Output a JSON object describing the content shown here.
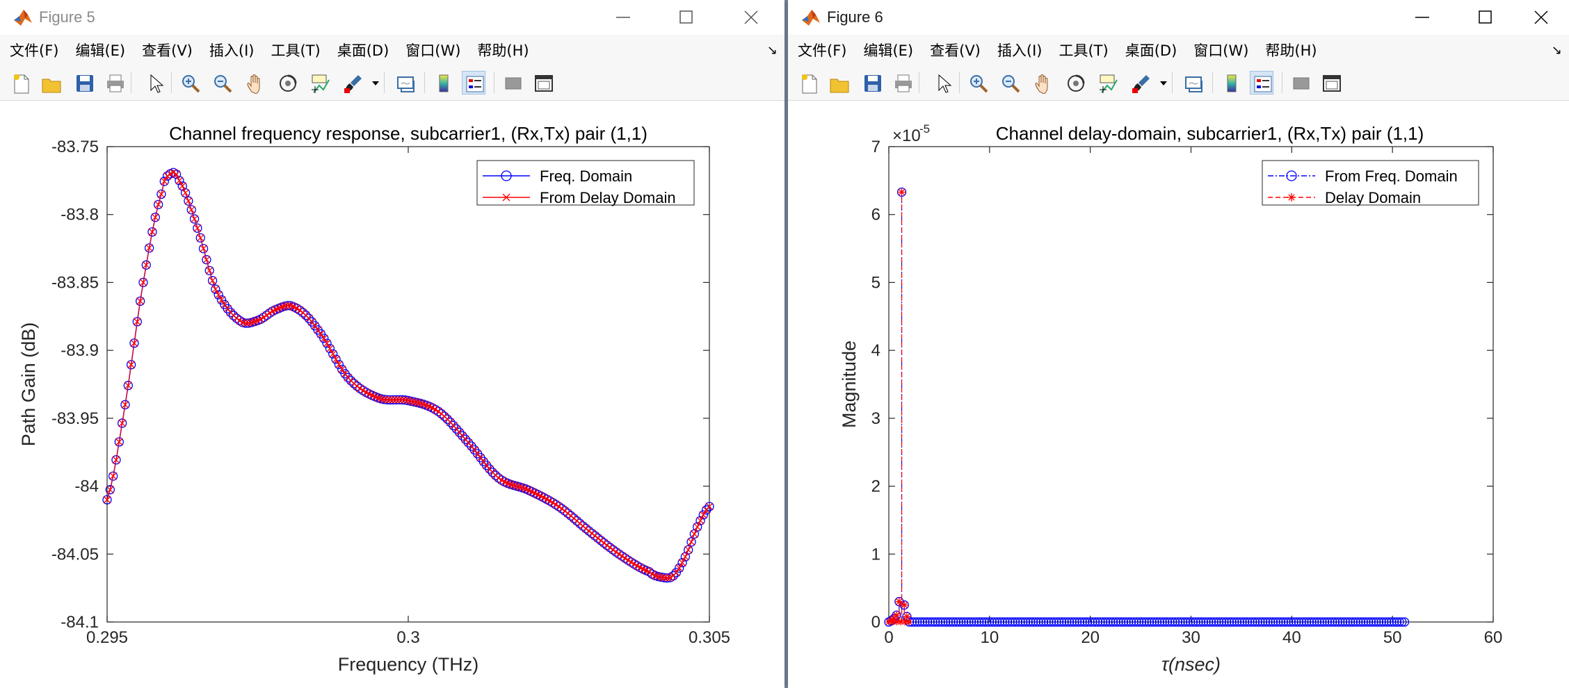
{
  "windows": [
    {
      "title": "Figure 5",
      "menu": [
        "文件(F)",
        "编辑(E)",
        "查看(V)",
        "插入(I)",
        "工具(T)",
        "桌面(D)",
        "窗口(W)",
        "帮助(H)"
      ],
      "menu_overflow": "↘"
    },
    {
      "title": "Figure 6",
      "menu": [
        "文件(F)",
        "编辑(E)",
        "查看(V)",
        "插入(I)",
        "工具(T)",
        "桌面(D)",
        "窗口(W)",
        "帮助(H)"
      ],
      "menu_overflow": "↘"
    }
  ],
  "toolbar_icons": [
    "new-figure-icon",
    "open-file-icon",
    "save-icon",
    "print-icon",
    "select-arrow-icon",
    "zoom-in-icon",
    "zoom-out-icon",
    "pan-hand-icon",
    "rotate-3d-icon",
    "data-cursor-icon",
    "brush-icon",
    "brush-dropdown-icon",
    "link-plot-icon",
    "colorbar-icon",
    "legend-icon",
    "hide-plot-tools-icon",
    "show-plot-tools-icon"
  ],
  "colors": {
    "blue": "#0000ff",
    "red": "#ff0000",
    "axes": "#262626",
    "title": "#000000"
  },
  "chart_data": [
    {
      "type": "line",
      "title": "Channel frequency response, subcarrier1, (Rx,Tx) pair (1,1)",
      "xlabel": "Frequency (THz)",
      "ylabel": "Path Gain (dB)",
      "xlim": [
        0.295,
        0.305
      ],
      "ylim": [
        -84.1,
        -83.75
      ],
      "xticks": [
        0.295,
        0.3,
        0.305
      ],
      "xtick_labels": [
        "0.295",
        "0.3",
        "0.305"
      ],
      "yticks": [
        -84.1,
        -84.05,
        -84,
        -83.95,
        -83.9,
        -83.85,
        -83.8,
        -83.75
      ],
      "ytick_labels": [
        "-84.1",
        "-84.05",
        "-84",
        "-83.95",
        "-83.9",
        "-83.85",
        "-83.8",
        "-83.75"
      ],
      "grid": false,
      "legend_position": "top-right",
      "x_points_count": 201,
      "curve_knots": {
        "x": [
          0.295,
          0.2953,
          0.2956,
          0.2959,
          0.29605,
          0.2962,
          0.2965,
          0.2968,
          0.2972,
          0.2975,
          0.2978,
          0.2981,
          0.2985,
          0.299,
          0.2995,
          0.3,
          0.3005,
          0.301,
          0.3015,
          0.302,
          0.3025,
          0.303,
          0.3035,
          0.304,
          0.3042,
          0.3044,
          0.3046,
          0.3048,
          0.305
        ],
        "y": [
          -84.01,
          -83.94,
          -83.85,
          -83.785,
          -83.77,
          -83.775,
          -83.81,
          -83.855,
          -83.878,
          -83.878,
          -83.87,
          -83.868,
          -83.885,
          -83.92,
          -83.935,
          -83.937,
          -83.945,
          -83.968,
          -83.994,
          -84.003,
          -84.015,
          -84.033,
          -84.05,
          -84.063,
          -84.067,
          -84.066,
          -84.052,
          -84.03,
          -84.015
        ]
      },
      "series": [
        {
          "name": "Freq. Domain",
          "color": "#0000ff",
          "marker": "circle",
          "linestyle": "solid"
        },
        {
          "name": "From Delay Domain",
          "color": "#ff0000",
          "marker": "x",
          "linestyle": "solid"
        }
      ]
    },
    {
      "type": "line",
      "title": "Channel delay-domain, subcarrier1, (Rx,Tx) pair (1,1)",
      "xlabel": "τ(nsec)",
      "ylabel": "Magnitude",
      "exponent_label": "×10",
      "exponent_power": "-5",
      "xlim": [
        0,
        60
      ],
      "ylim": [
        0,
        7
      ],
      "xticks": [
        0,
        10,
        20,
        30,
        40,
        50,
        60
      ],
      "xtick_labels": [
        "0",
        "10",
        "20",
        "30",
        "40",
        "50",
        "60"
      ],
      "yticks": [
        0,
        1,
        2,
        3,
        4,
        5,
        6,
        7
      ],
      "ytick_labels": [
        "0",
        "1",
        "2",
        "3",
        "4",
        "5",
        "6",
        "7"
      ],
      "grid": false,
      "legend_position": "top-right",
      "delay_samples": {
        "start": 0,
        "end": 51.2,
        "count": 201
      },
      "nonzero_points": {
        "x": [
          0.256,
          0.512,
          0.768,
          1.024,
          1.28,
          1.536,
          1.792
        ],
        "y": [
          0.02,
          0.05,
          0.1,
          0.3,
          6.33,
          0.25,
          0.08
        ]
      },
      "series": [
        {
          "name": "From Freq. Domain",
          "color": "#0000ff",
          "marker": "circle",
          "linestyle": "dashdot"
        },
        {
          "name": "Delay Domain",
          "color": "#ff0000",
          "marker": "asterisk",
          "linestyle": "dashed"
        }
      ]
    }
  ]
}
